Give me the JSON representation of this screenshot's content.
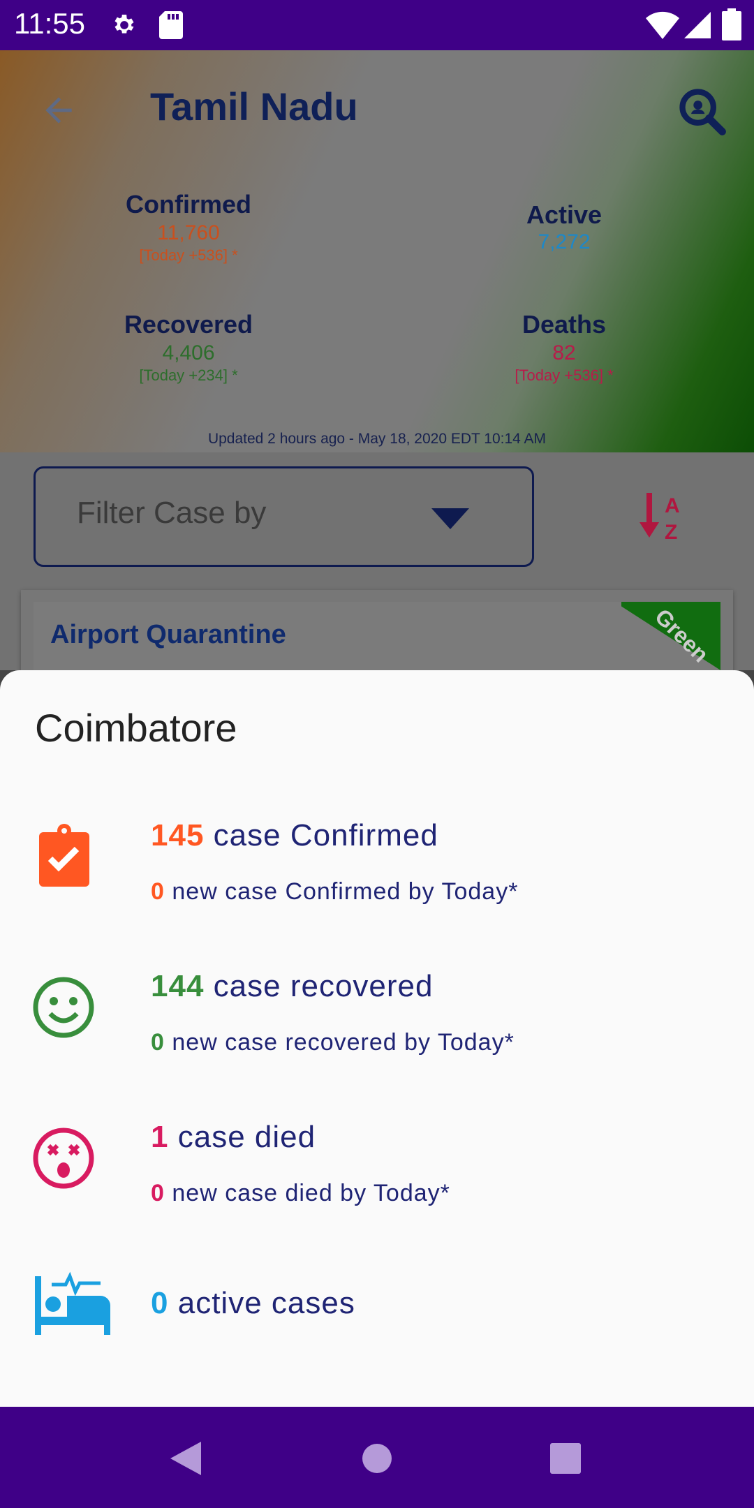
{
  "status_bar": {
    "time": "11:55"
  },
  "header": {
    "title": "Tamil Nadu",
    "confirmed": {
      "label": "Confirmed",
      "value": "11,760",
      "today": "[Today +536] *"
    },
    "active": {
      "label": "Active",
      "value": "7,272"
    },
    "recovered": {
      "label": "Recovered",
      "value": "4,406",
      "today": "[Today +234] *"
    },
    "deaths": {
      "label": "Deaths",
      "value": "82",
      "today": "[Today +536] *"
    },
    "updated": "Updated 2 hours ago - May 18, 2020 EDT 10:14 AM"
  },
  "filter": {
    "placeholder": "Filter Case by"
  },
  "card": {
    "title": "Airport Quarantine",
    "zone": "Green"
  },
  "sheet": {
    "title": "Coimbatore",
    "confirmed": {
      "num": "145",
      "text": "case Confirmed",
      "new_num": "0",
      "new_text": "new case Confirmed by Today*"
    },
    "recovered": {
      "num": "144",
      "text": "case recovered",
      "new_num": "0",
      "new_text": "new case recovered by Today*"
    },
    "died": {
      "num": "1",
      "text": "case died",
      "new_num": "0",
      "new_text": "new case died by Today*"
    },
    "active": {
      "num": "0",
      "text": "active cases"
    }
  },
  "colors": {
    "confirmed": "#ff5722",
    "recovered": "#388e3c",
    "died": "#d81b60",
    "active": "#1aa0e0",
    "text_dark": "#1f2474",
    "system_bar": "#3f0087"
  }
}
